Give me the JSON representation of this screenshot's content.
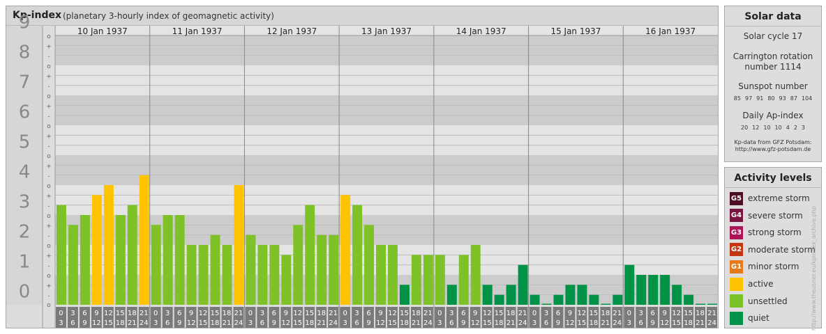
{
  "header": {
    "title": "Kp-index",
    "subtitle": "(planetary 3-hourly index of geomagnetic activity)"
  },
  "colors": {
    "quiet": "#009247",
    "unsettled": "#7ec228",
    "active": "#ffc300",
    "G1": "#e47a1a",
    "G2": "#c43513",
    "G3": "#ad1457",
    "G4": "#7a1340",
    "G5": "#4a0d24"
  },
  "chart_data": {
    "type": "bar",
    "title": "Kp-index",
    "subtitle": "(planetary 3-hourly index of geomagnetic activity)",
    "ylim": [
      0,
      9
    ],
    "y_ticks": [
      "0",
      "1",
      "2",
      "3",
      "4",
      "5",
      "6",
      "7",
      "8",
      "9"
    ],
    "minor_marks": [
      "o",
      "+",
      "-"
    ],
    "days": [
      "10 Jan 1937",
      "11 Jan 1937",
      "12 Jan 1937",
      "13 Jan 1937",
      "14 Jan 1937",
      "15 Jan 1937",
      "16 Jan 1937"
    ],
    "hour_labels": [
      [
        "0",
        "3"
      ],
      [
        "3",
        "6"
      ],
      [
        "6",
        "9"
      ],
      [
        "9",
        "12"
      ],
      [
        "12",
        "15"
      ],
      [
        "15",
        "18"
      ],
      [
        "18",
        "21"
      ],
      [
        "21",
        "24"
      ]
    ],
    "values": [
      3.333,
      2.667,
      3.0,
      3.667,
      4.0,
      3.0,
      3.333,
      4.333,
      2.667,
      3.0,
      3.0,
      2.0,
      2.0,
      2.333,
      2.0,
      4.0,
      2.333,
      2.0,
      2.0,
      1.667,
      2.667,
      3.333,
      2.333,
      2.333,
      3.667,
      3.333,
      2.667,
      2.0,
      2.0,
      0.667,
      1.667,
      1.667,
      1.667,
      0.667,
      1.667,
      2.0,
      0.667,
      0.333,
      0.667,
      1.333,
      0.333,
      0.0,
      0.333,
      0.667,
      0.667,
      0.333,
      0.0,
      0.333,
      1.333,
      1.0,
      1.0,
      1.0,
      0.667,
      0.333,
      0.0,
      0.0
    ]
  },
  "solar": {
    "header": "Solar data",
    "cycle": "Solar cycle 17",
    "carrington_1": "Carrington rotation",
    "carrington_2": "number 1114",
    "sunspot_label": "Sunspot number",
    "sunspot_values": [
      "85",
      "97",
      "91",
      "80",
      "93",
      "87",
      "104"
    ],
    "ap_label": "Daily Ap-index",
    "ap_values": [
      "20",
      "12",
      "10",
      "10",
      "4",
      "2",
      "3"
    ],
    "credit_1": "Kp-data from GFZ Potsdam:",
    "credit_2": "http://www.gfz-potsdam.de"
  },
  "activity": {
    "header": "Activity levels",
    "items": [
      {
        "code": "G5",
        "label": "extreme storm",
        "color": "#4a0d24"
      },
      {
        "code": "G4",
        "label": "severe storm",
        "color": "#7a1340"
      },
      {
        "code": "G3",
        "label": "strong storm",
        "color": "#ad1457"
      },
      {
        "code": "G2",
        "label": "moderate storm",
        "color": "#c43513"
      },
      {
        "code": "G1",
        "label": "minor storm",
        "color": "#e47a1a"
      },
      {
        "code": "",
        "label": "active",
        "color": "#ffc300"
      },
      {
        "code": "",
        "label": "unsettled",
        "color": "#7ec228"
      },
      {
        "code": "",
        "label": "quiet",
        "color": "#009247"
      }
    ]
  },
  "side_credit": "http://www.theusner.eu/kpindex_archive.php"
}
